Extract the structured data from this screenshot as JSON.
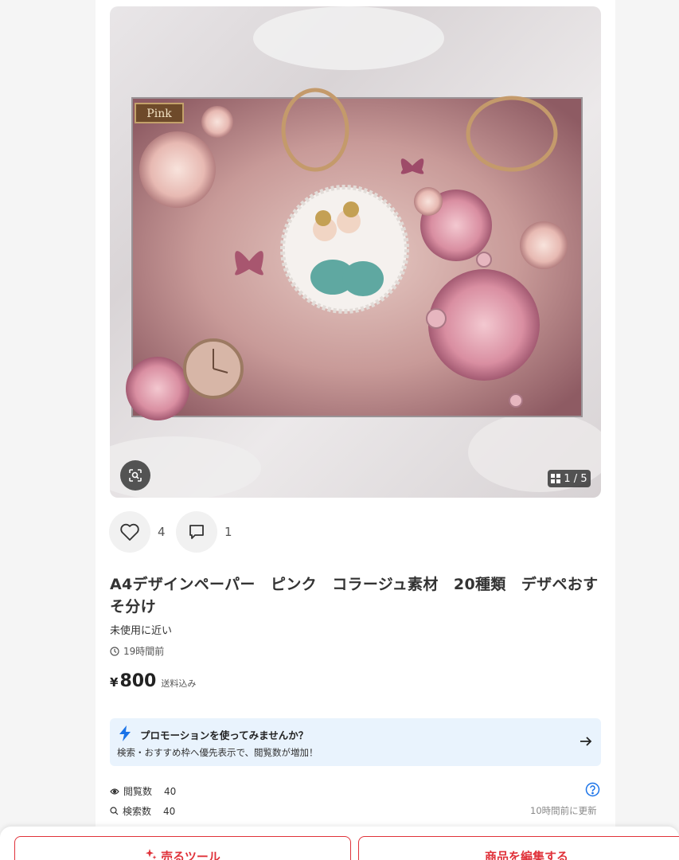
{
  "image": {
    "label_tag": "Pink",
    "counter": "1 / 5"
  },
  "actions": {
    "like_count": "4",
    "comment_count": "1"
  },
  "product": {
    "title": "A4デザインペーパー　ピンク　コラージュ素材　20種類　デザペおすそ分け",
    "condition": "未使用に近い",
    "posted_time": "19時間前",
    "price_symbol": "¥",
    "price": "800",
    "shipping": "送料込み"
  },
  "promotion": {
    "title": "プロモーションを使ってみませんか？",
    "description": "検索・おすすめ枠へ優先表示で、閲覧数が増加！"
  },
  "stats": {
    "views_label": "閲覧数",
    "views_value": "40",
    "searches_label": "検索数",
    "searches_value": "40",
    "updated": "10時間前に更新"
  },
  "bottom": {
    "sell_tools_label": "売るツール",
    "edit_label": "商品を編集する"
  },
  "colors": {
    "accent_red": "#e0323a",
    "promo_bg": "#e9f3fd",
    "bolt_blue": "#1a73e8"
  }
}
